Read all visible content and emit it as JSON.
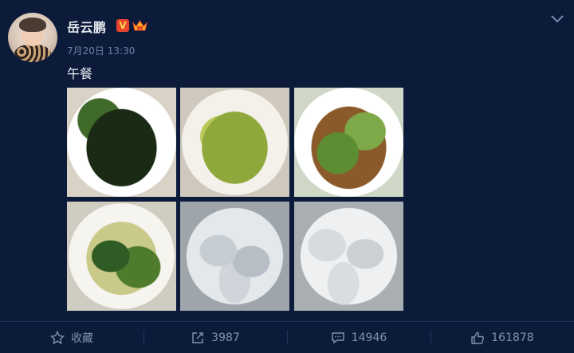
{
  "post": {
    "author": "岳云鹏",
    "verified_badge": "V",
    "timestamp": "7月20日 13:30",
    "text": "午餐"
  },
  "photos": [
    {
      "subject": "stir-fried greens"
    },
    {
      "subject": "stir-fried green peppers"
    },
    {
      "subject": "stir-fried lettuce"
    },
    {
      "subject": "cucumber salad"
    },
    {
      "subject": "dumplings"
    },
    {
      "subject": "dumplings"
    }
  ],
  "actions": {
    "favorite": {
      "label": "收藏",
      "icon": "star-icon"
    },
    "repost": {
      "count": "3987",
      "icon": "share-icon"
    },
    "comment": {
      "count": "14946",
      "icon": "comment-icon"
    },
    "like": {
      "count": "161878",
      "icon": "thumbs-up-icon"
    }
  },
  "colors": {
    "background": "#0c1b3a",
    "badge_red": "#e8442f",
    "badge_gold": "#ffd54a",
    "muted_text": "#8391ad"
  }
}
